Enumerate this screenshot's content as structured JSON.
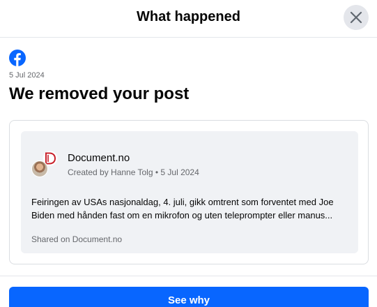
{
  "dialog": {
    "title": "What happened",
    "close_icon": "close-icon"
  },
  "notice": {
    "logo_icon": "facebook-logo-icon",
    "date": "5 Jul 2024",
    "heading": "We removed your post"
  },
  "post": {
    "page_name": "Document.no",
    "created_by": "Created by Hanne Tolg • 5 Jul 2024",
    "text": "Feiringen av USAs nasjonaldag, 4. juli, gikk omtrent som forventet med Joe Biden med hånden fast om en mikrofon og uten teleprompter eller manus...",
    "shared_on": "Shared on Document.no"
  },
  "actions": {
    "see_why_label": "See why"
  },
  "colors": {
    "facebook_blue": "#0866ff",
    "close_button_bg": "#e4e6eb",
    "card_bg": "#f0f2f5",
    "secondary_text": "#65676b"
  }
}
